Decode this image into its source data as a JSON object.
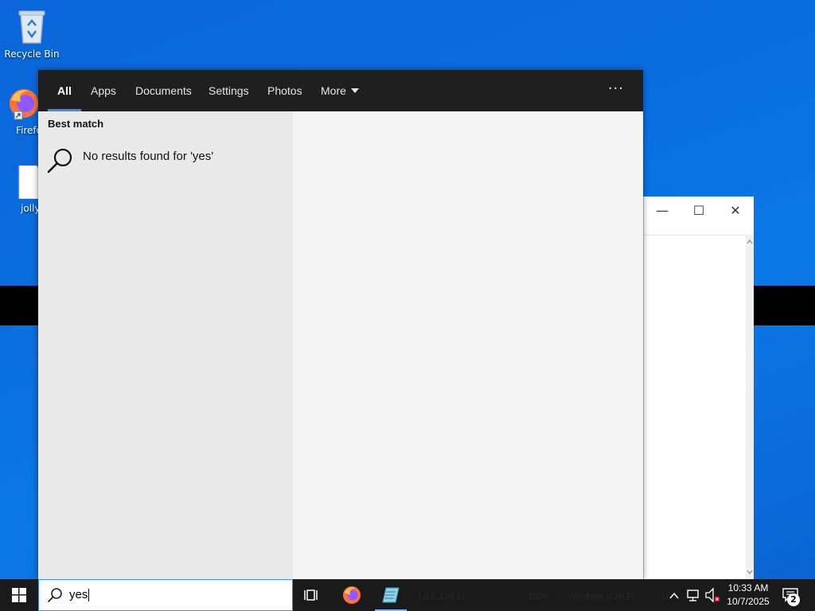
{
  "desktop": {
    "icons": [
      {
        "label": "Recycle Bin"
      },
      {
        "label": "Firefox"
      },
      {
        "label": "jolly"
      }
    ]
  },
  "search": {
    "tabs": [
      {
        "label": "All",
        "active": true
      },
      {
        "label": "Apps"
      },
      {
        "label": "Documents"
      },
      {
        "label": "Settings"
      },
      {
        "label": "Photos"
      },
      {
        "label": "More"
      }
    ],
    "more_options": "···",
    "section_title": "Best match",
    "no_results": "No results found for 'yes'",
    "query": "yes"
  },
  "background_window": {
    "status": {
      "position": "Ln 2, Col 12",
      "zoom": "100%",
      "line_endings": "Windows (CRLF)",
      "encoding": "UTF-8"
    }
  },
  "taskbar": {
    "time": "10:33 AM",
    "date": "10/7/2025",
    "notification_count": "2"
  },
  "colors": {
    "accent": "#3a8ee6",
    "desktop": "#0a6ee0",
    "taskbar": "#1a1a1a",
    "tabbar": "#1f1f1f"
  }
}
